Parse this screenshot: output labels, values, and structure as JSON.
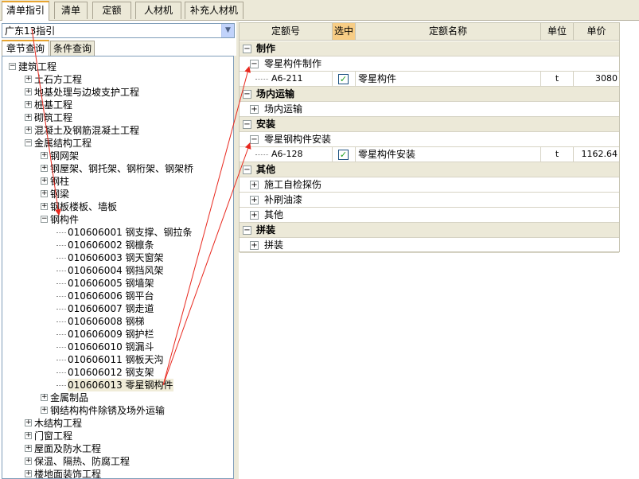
{
  "top_tabs": [
    "清单指引",
    "清单",
    "定额",
    "人材机",
    "补充人材机"
  ],
  "combo": {
    "value": "广东13指引"
  },
  "sub_tabs": [
    "章节查询",
    "条件查询"
  ],
  "tree": [
    {
      "label": "建筑工程",
      "level": 0,
      "state": "open"
    },
    {
      "label": "土石方工程",
      "level": 1,
      "state": "closed"
    },
    {
      "label": "地基处理与边坡支护工程",
      "level": 1,
      "state": "closed"
    },
    {
      "label": "桩基工程",
      "level": 1,
      "state": "closed"
    },
    {
      "label": "砌筑工程",
      "level": 1,
      "state": "closed"
    },
    {
      "label": "混凝土及钢筋混凝土工程",
      "level": 1,
      "state": "closed"
    },
    {
      "label": "金属结构工程",
      "level": 1,
      "state": "open"
    },
    {
      "label": "钢网架",
      "level": 2,
      "state": "closed"
    },
    {
      "label": "钢屋架、钢托架、钢桁架、钢架桥",
      "level": 2,
      "state": "closed"
    },
    {
      "label": "钢柱",
      "level": 2,
      "state": "closed"
    },
    {
      "label": "钢梁",
      "level": 2,
      "state": "closed"
    },
    {
      "label": "钢板楼板、墙板",
      "level": 2,
      "state": "closed"
    },
    {
      "label": "钢构件",
      "level": 2,
      "state": "open"
    },
    {
      "label": "010606001  钢支撑、钢拉条",
      "level": 3,
      "state": "leaf"
    },
    {
      "label": "010606002  钢檩条",
      "level": 3,
      "state": "leaf"
    },
    {
      "label": "010606003  钢天窗架",
      "level": 3,
      "state": "leaf"
    },
    {
      "label": "010606004  钢挡风架",
      "level": 3,
      "state": "leaf"
    },
    {
      "label": "010606005  钢墙架",
      "level": 3,
      "state": "leaf"
    },
    {
      "label": "010606006  钢平台",
      "level": 3,
      "state": "leaf"
    },
    {
      "label": "010606007  钢走道",
      "level": 3,
      "state": "leaf"
    },
    {
      "label": "010606008  钢梯",
      "level": 3,
      "state": "leaf"
    },
    {
      "label": "010606009  钢护栏",
      "level": 3,
      "state": "leaf"
    },
    {
      "label": "010606010  钢漏斗",
      "level": 3,
      "state": "leaf"
    },
    {
      "label": "010606011  钢板天沟",
      "level": 3,
      "state": "leaf"
    },
    {
      "label": "010606012  钢支架",
      "level": 3,
      "state": "leaf"
    },
    {
      "label": "010606013  零星钢构件",
      "level": 3,
      "state": "leaf",
      "selected": true
    },
    {
      "label": "金属制品",
      "level": 2,
      "state": "closed"
    },
    {
      "label": "钢结构构件除锈及场外运输",
      "level": 2,
      "state": "closed"
    },
    {
      "label": "木结构工程",
      "level": 1,
      "state": "closed"
    },
    {
      "label": "门窗工程",
      "level": 1,
      "state": "closed"
    },
    {
      "label": "屋面及防水工程",
      "level": 1,
      "state": "closed"
    },
    {
      "label": "保温、隔热、防腐工程",
      "level": 1,
      "state": "closed"
    },
    {
      "label": "楼地面装饰工程",
      "level": 1,
      "state": "closed"
    }
  ],
  "grid": {
    "headers": {
      "code": "定额号",
      "selected": "选中",
      "name": "定额名称",
      "unit": "单位",
      "price": "单价"
    },
    "rows": [
      {
        "kind": "group",
        "title": "制作",
        "state": "open"
      },
      {
        "kind": "sub",
        "title": "零星构件制作",
        "state": "open"
      },
      {
        "kind": "data",
        "code": "A6-211",
        "checked": true,
        "name": "零星构件",
        "unit": "t",
        "price": "3080"
      },
      {
        "kind": "group",
        "title": "场内运输",
        "state": "open"
      },
      {
        "kind": "sub",
        "title": "场内运输",
        "state": "closed"
      },
      {
        "kind": "group",
        "title": "安装",
        "state": "open"
      },
      {
        "kind": "sub",
        "title": "零星钢构件安装",
        "state": "open"
      },
      {
        "kind": "data",
        "code": "A6-128",
        "checked": true,
        "name": "零星构件安装",
        "unit": "t",
        "price": "1162.64"
      },
      {
        "kind": "group",
        "title": "其他",
        "state": "open"
      },
      {
        "kind": "sub",
        "title": "施工自检探伤",
        "state": "closed"
      },
      {
        "kind": "sub",
        "title": "补刷油漆",
        "state": "closed"
      },
      {
        "kind": "sub",
        "title": "其他",
        "state": "closed"
      },
      {
        "kind": "group",
        "title": "拼装",
        "state": "open"
      },
      {
        "kind": "sub",
        "title": "拼装",
        "state": "closed"
      }
    ]
  },
  "colors": {
    "annotation_arrow": "#e8281e",
    "active_tab_accent": "#e8a531",
    "header_highlight": "#f7cd85"
  }
}
